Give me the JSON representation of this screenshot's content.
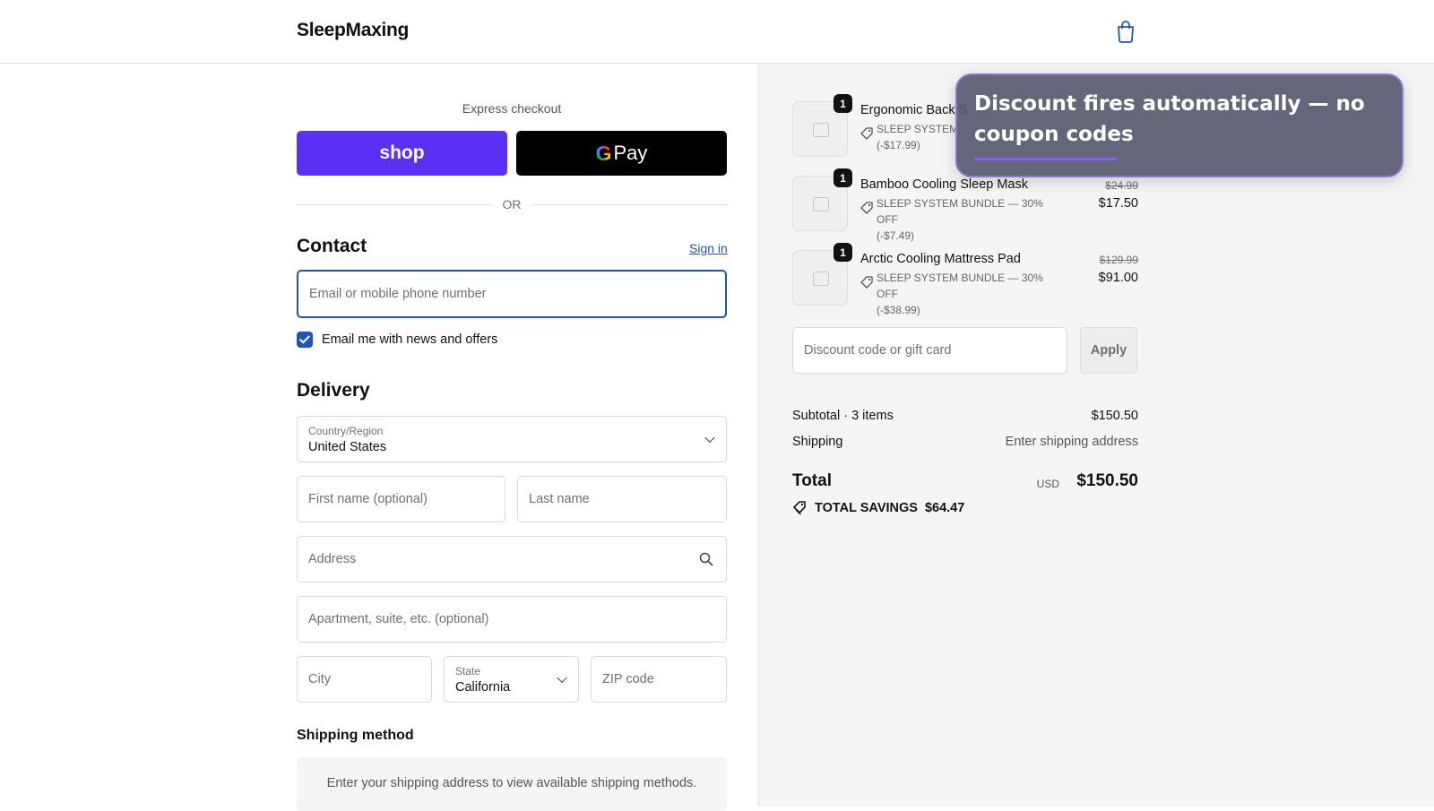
{
  "header": {
    "brand": "SleepMaxing",
    "cart_icon": "shopping-bag-icon"
  },
  "express": {
    "label": "Express checkout",
    "shop_label": "shop",
    "gpay_g": "G",
    "gpay_label": "Pay",
    "or": "OR"
  },
  "contact": {
    "heading": "Contact",
    "sign_in": "Sign in",
    "email_placeholder": "Email or mobile phone number",
    "newsletter_label": "Email me with news and offers",
    "newsletter_checked": true
  },
  "delivery": {
    "heading": "Delivery",
    "country_label": "Country/Region",
    "country_value": "United States",
    "first_name_placeholder": "First name (optional)",
    "last_name_placeholder": "Last name",
    "address_placeholder": "Address",
    "apartment_placeholder": "Apartment, suite, etc. (optional)",
    "city_placeholder": "City",
    "state_label": "State",
    "state_value": "California",
    "zip_placeholder": "ZIP code"
  },
  "shipping": {
    "heading": "Shipping method",
    "message": "Enter your shipping address to view available shipping methods."
  },
  "cart": {
    "items": [
      {
        "qty": "1",
        "name": "Ergonomic Back S",
        "discount_line1": "SLEEP SYSTEM",
        "discount_line2": "(-$17.99)",
        "old_price": "",
        "price": ""
      },
      {
        "qty": "1",
        "name": "Bamboo Cooling Sleep Mask",
        "discount_line1": "SLEEP SYSTEM BUNDLE — 30% OFF",
        "discount_line2": "(-$7.49)",
        "old_price": "$24.99",
        "price": "$17.50"
      },
      {
        "qty": "1",
        "name": "Arctic Cooling Mattress Pad",
        "discount_line1": "SLEEP SYSTEM BUNDLE — 30% OFF",
        "discount_line2": "(-$38.99)",
        "old_price": "$129.99",
        "price": "$91.00"
      }
    ],
    "discount_placeholder": "Discount code or gift card",
    "apply_label": "Apply",
    "subtotal_label": "Subtotal · 3 items",
    "subtotal_value": "$150.50",
    "shipping_label": "Shipping",
    "shipping_value": "Enter shipping address",
    "total_label": "Total",
    "currency": "USD",
    "total_value": "$150.50",
    "savings_label": "TOTAL SAVINGS",
    "savings_value": "$64.47"
  },
  "overlay": {
    "text": "Discount fires automatically — no coupon codes"
  },
  "colors": {
    "accent": "#1f56b5",
    "shop": "#5a31f4",
    "overlay_bar": "#8b5cf6"
  }
}
